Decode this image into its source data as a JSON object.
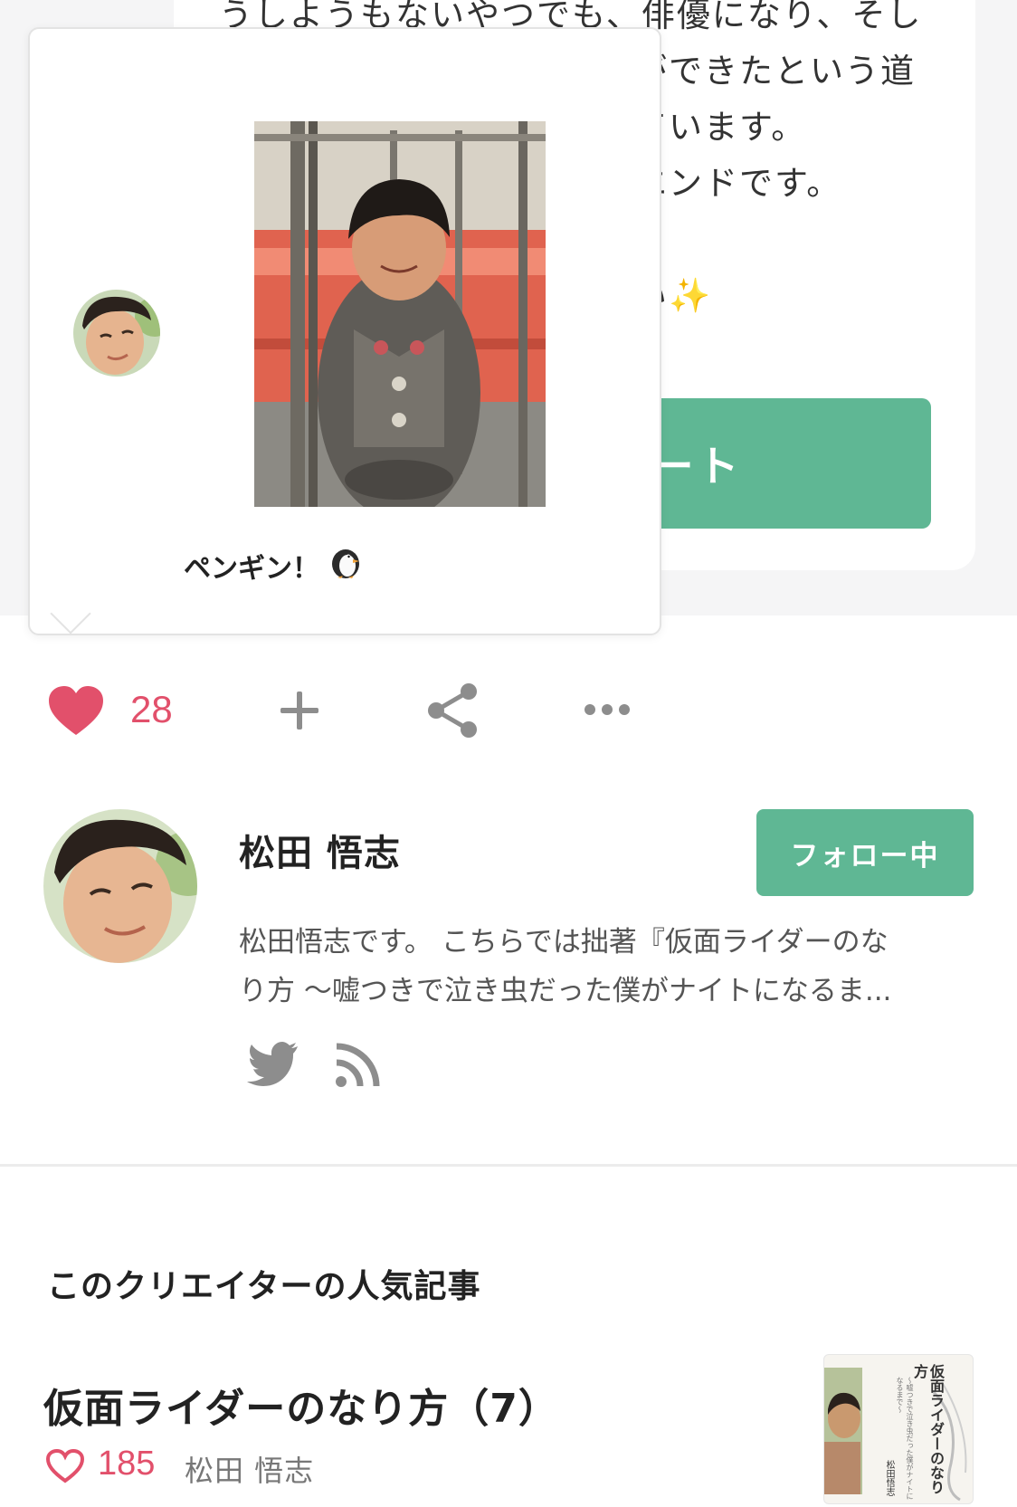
{
  "article": {
    "lines": [
      "うしようもないやつでも、俳優になり、そし",
      "ができたという道",
      "ています。",
      "エンドです。",
      "い✨"
    ],
    "support_label": "サポート"
  },
  "popover": {
    "caption": "ペンギン！",
    "caption_icon": "penguin-icon"
  },
  "actions": {
    "like_icon": "heart-filled-icon",
    "like_count": "28",
    "add_icon": "plus-icon",
    "share_icon": "share-icon",
    "more_icon": "ellipsis-icon"
  },
  "creator": {
    "name": "松田 悟志",
    "follow_label": "フォロー中",
    "bio_lines": [
      "松田悟志です。 こちらでは拙著『仮面ライダーのな",
      "り方 〜嘘つきで泣き虫だった僕がナイトになるま..."
    ],
    "social_icons": [
      "twitter-icon",
      "rss-icon"
    ]
  },
  "popular": {
    "section_title": "このクリエイターの人気記事",
    "articles": [
      {
        "title": "仮面ライダーのなり方（7）",
        "like_count": "185",
        "author": "松田 悟志",
        "thumb_title": "仮面ライダーのなり方",
        "thumb_subtitle": "〜嘘つきで泣き虫だった僕がナイトになるまで〜",
        "thumb_author": "松田悟志"
      }
    ]
  },
  "colors": {
    "accent_green": "#5fb794",
    "like_red": "#e2506b",
    "background_grey": "#f5f5f6"
  }
}
